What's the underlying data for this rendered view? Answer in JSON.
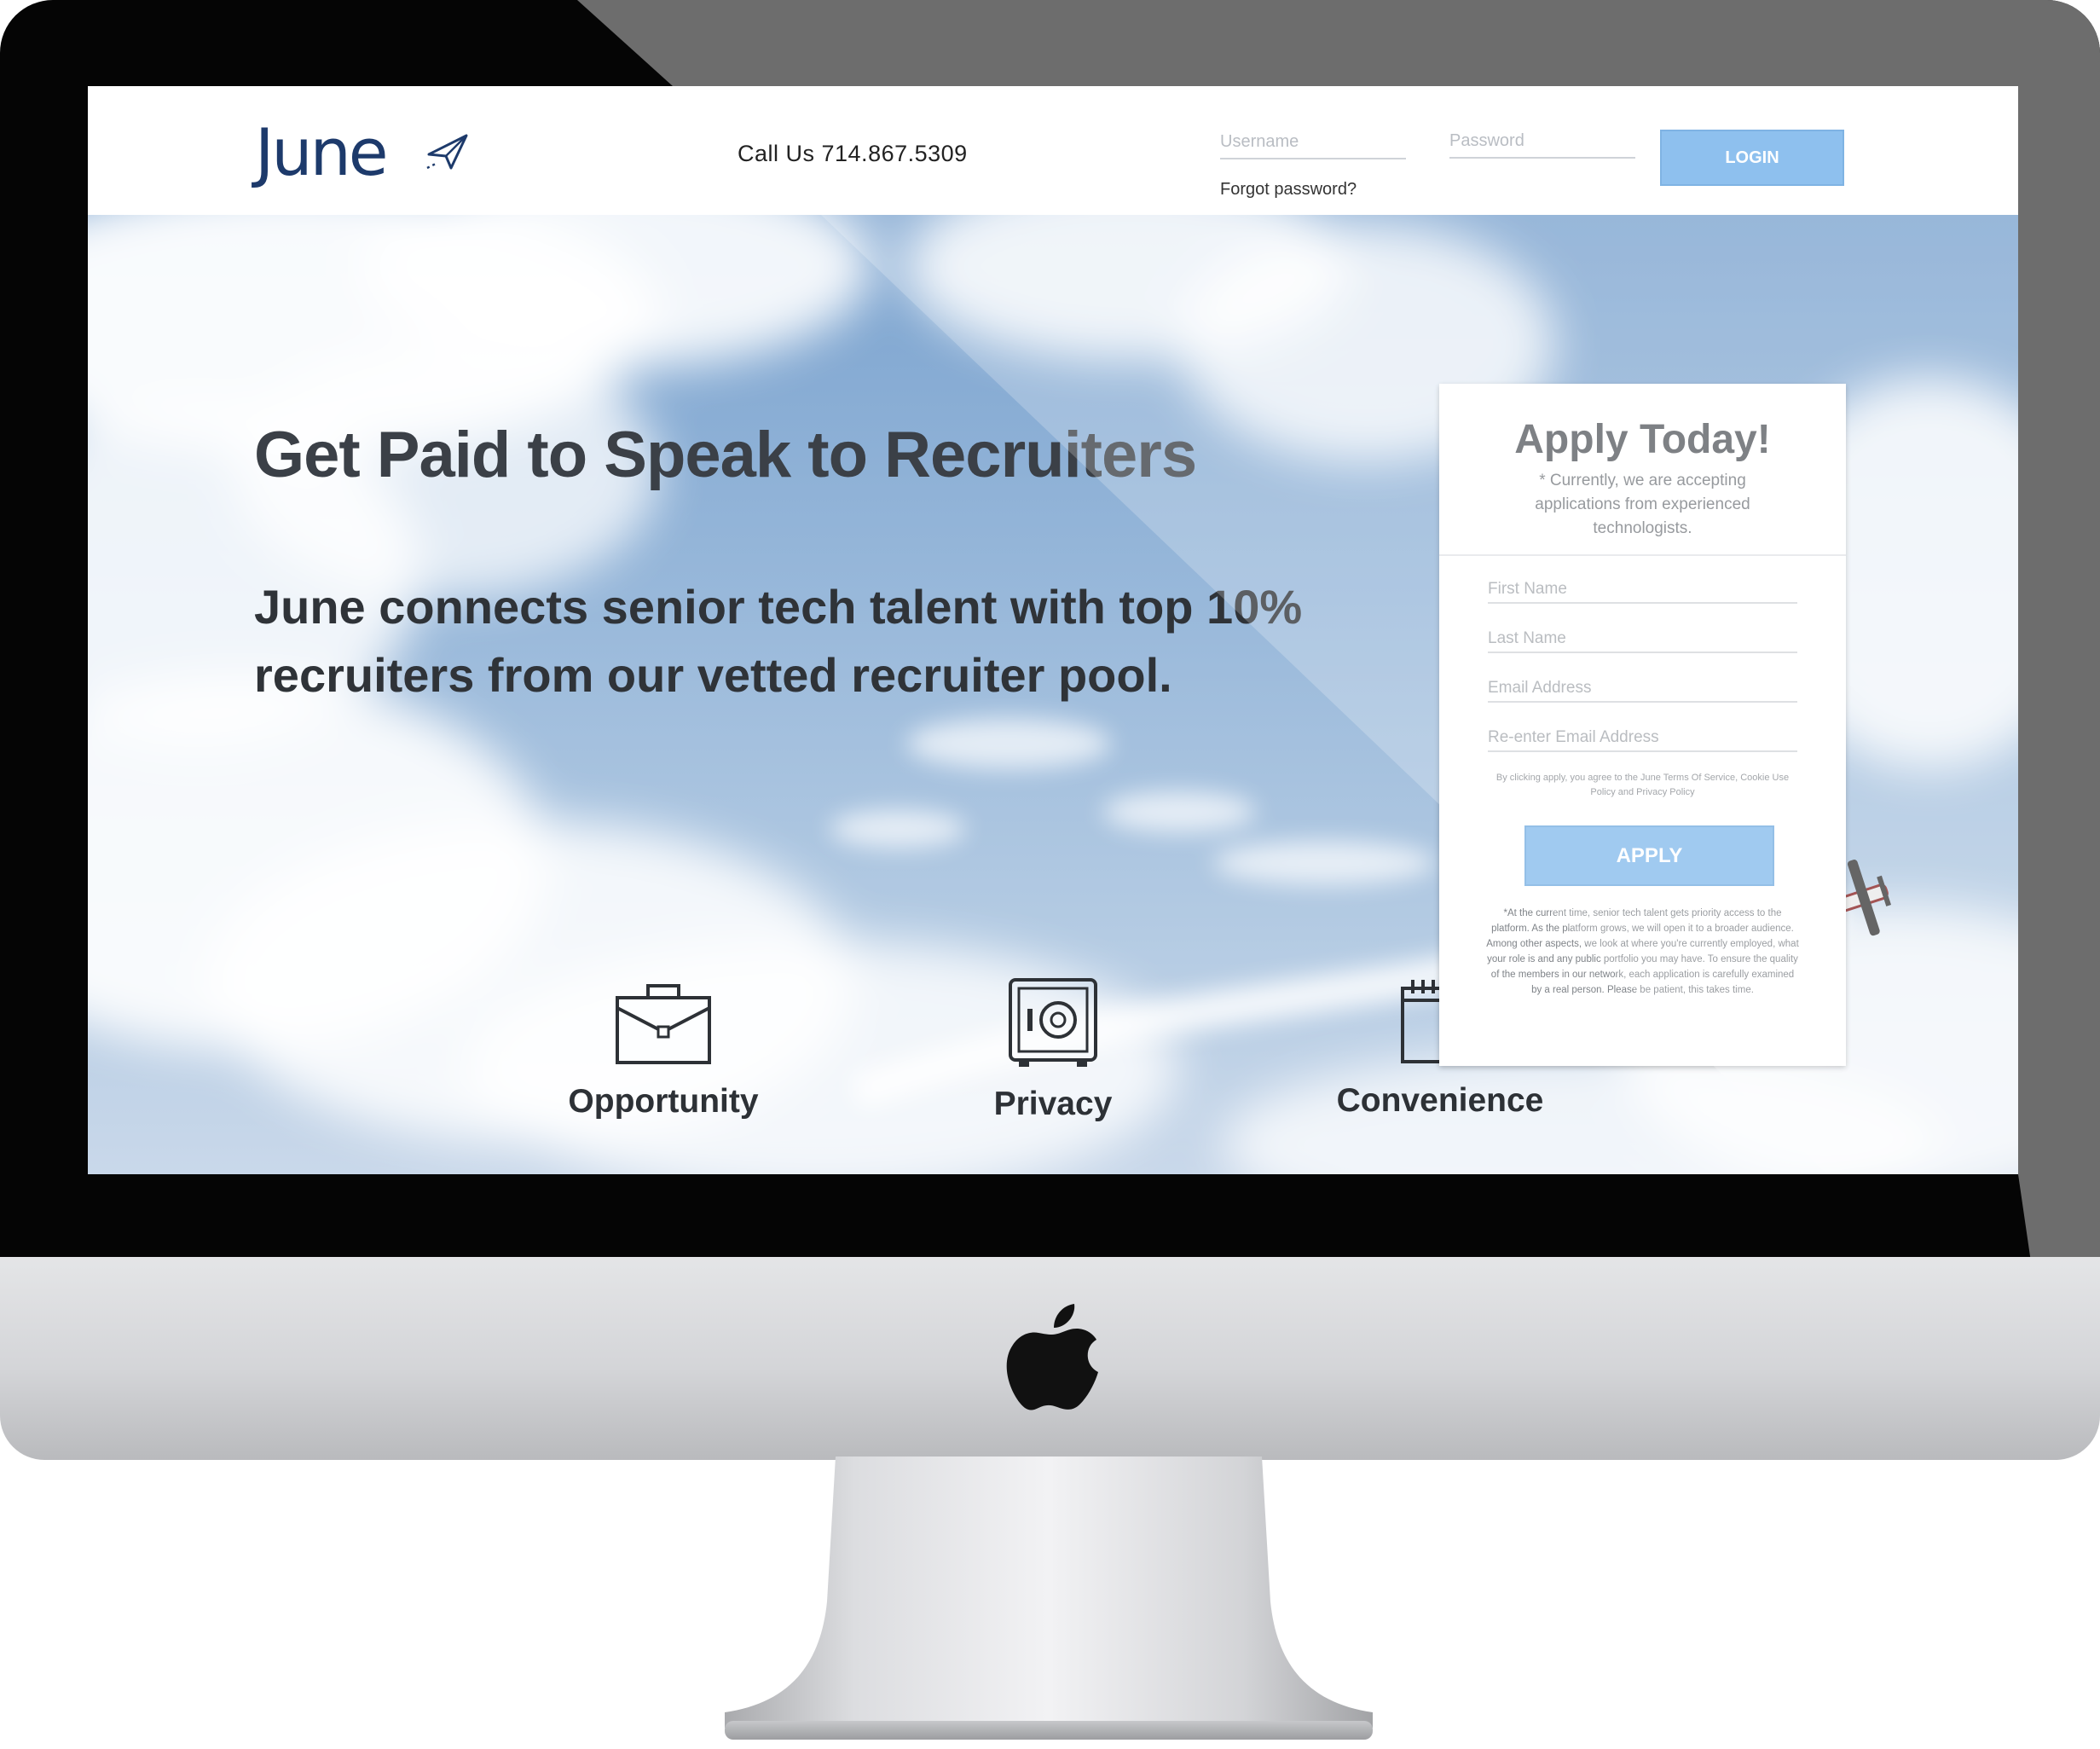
{
  "colors": {
    "brand_navy": "#1d3a6b",
    "button_blue": "#8ec0ee",
    "sky_blue": "#7ba3cf",
    "headline_text": "#3b4047",
    "bezel_black": "#050505",
    "aluminum": "#d4d5d8"
  },
  "nav": {
    "logo_text": "June",
    "logo_icon": "paper-plane-icon",
    "phone_text": "Call Us 714.867.5309",
    "username_placeholder": "Username",
    "password_placeholder": "Password",
    "forgot_password": "Forgot password?",
    "login_label": "LOGIN"
  },
  "hero": {
    "headline": "Get Paid to Speak to Recruiters",
    "subheadline": "June connects senior tech talent with top 10% recruiters from our vetted recruiter pool."
  },
  "apply_form": {
    "title": "Apply Today!",
    "note": "* Currently, we are accepting applications from experienced technologists.",
    "fields": [
      {
        "placeholder": "First Name"
      },
      {
        "placeholder": "Last Name"
      },
      {
        "placeholder": "Email Address"
      },
      {
        "placeholder": "Re-enter Email Address"
      }
    ],
    "terms": "By clicking apply, you agree to the June Terms Of Service, Cookie Use Policy and Privacy Policy",
    "apply_label": "APPLY",
    "fine_print": "*At the current time, senior tech talent gets priority access to the platform. As the platform grows, we will open it to a broader audience. Among other aspects, we look at where you're currently employed, what your role is and any public portfolio you may have. To ensure the quality of the members in our network, each application is carefully examined by a real person. Please be patient, this takes time."
  },
  "features": [
    {
      "label": "Opportunity",
      "icon": "briefcase-icon"
    },
    {
      "label": "Privacy",
      "icon": "safe-icon"
    },
    {
      "label": "Convenience",
      "icon": "calendar-icon"
    }
  ],
  "device": {
    "logo_icon": "apple-logo-icon"
  }
}
